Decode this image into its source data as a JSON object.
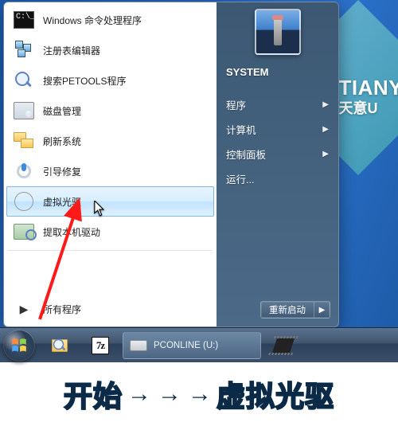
{
  "wallpaper": {
    "line1": "TIANY",
    "line2": "天意U"
  },
  "start": {
    "items": [
      {
        "label": "Windows 命令处理程序",
        "icon": "cmd"
      },
      {
        "label": "注册表编辑器",
        "icon": "cubes"
      },
      {
        "label": "搜索PETOOLS程序",
        "icon": "mag"
      },
      {
        "label": "磁盘管理",
        "icon": "disk"
      },
      {
        "label": "刷新系统",
        "icon": "folders"
      },
      {
        "label": "引导修复",
        "icon": "boot"
      },
      {
        "label": "虚拟光驱",
        "icon": "cd",
        "selected": true
      },
      {
        "label": "提取本机驱动",
        "icon": "drv"
      }
    ],
    "all_programs": "所有程序",
    "user": "SYSTEM",
    "right_links": [
      {
        "label": "程序",
        "sub": true
      },
      {
        "label": "计算机",
        "sub": true
      },
      {
        "label": "控制面板",
        "sub": true
      },
      {
        "label": "运行...",
        "sub": false
      }
    ],
    "restart": "重新启动"
  },
  "taskbar": {
    "active_task": "PCONLINE (U:)"
  },
  "caption": {
    "word1": "开始",
    "word2": "虚拟光驱",
    "arrow": "→"
  }
}
